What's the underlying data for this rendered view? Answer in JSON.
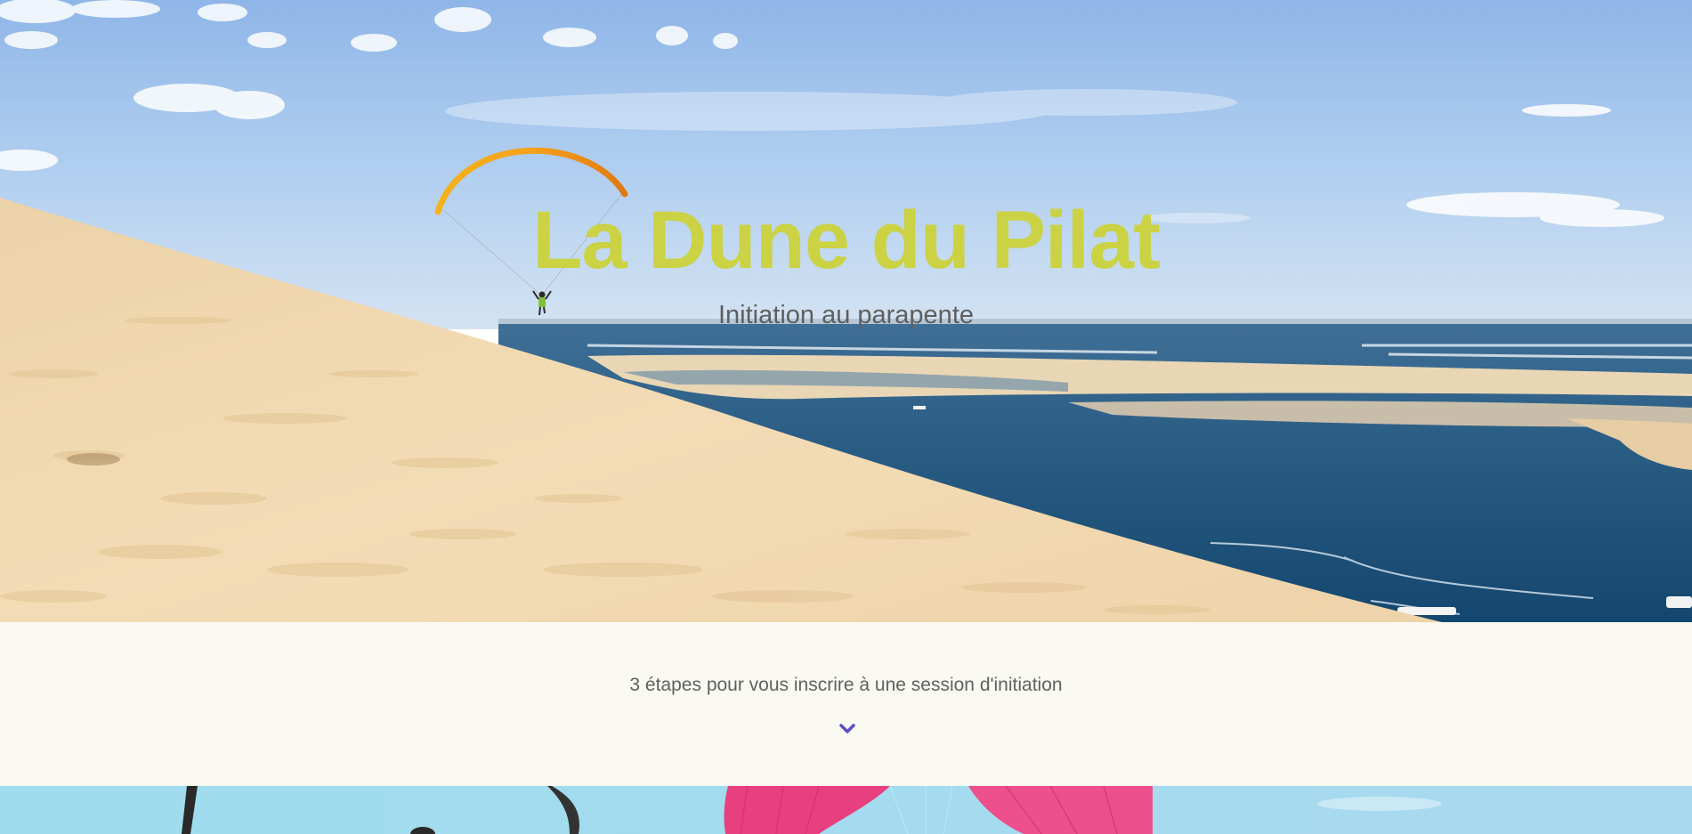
{
  "hero": {
    "title": "La Dune du Pilat",
    "subtitle": "Initiation au parapente"
  },
  "steps": {
    "intro_text": "3 étapes pour vous inscrire à une session d'initiation",
    "scroll_icon": "chevron-down-icon"
  },
  "colors": {
    "title": "#cbd244",
    "subtitle": "#5f5f5f",
    "band_background": "#fafaf3",
    "chevron": "#5b4fc7"
  }
}
